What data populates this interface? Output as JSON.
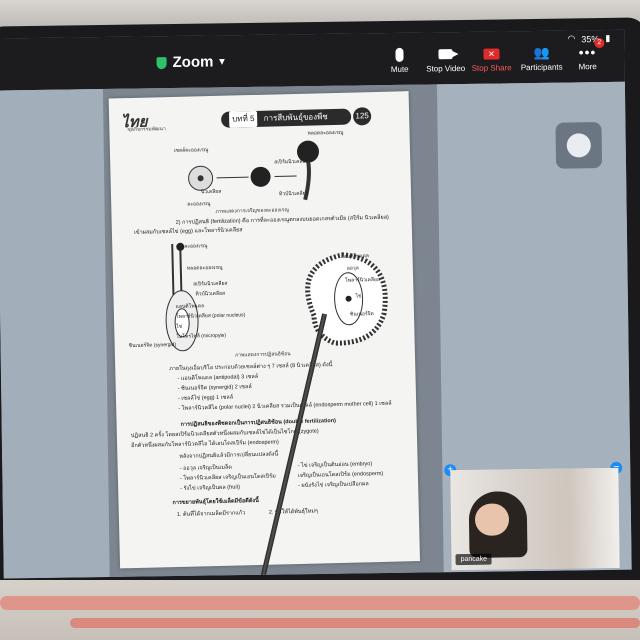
{
  "status": {
    "wifi_icon": "wifi-icon",
    "battery": "35%",
    "battery_icon": "battery-icon"
  },
  "app": {
    "title": "Zoom",
    "shield_icon": "shield-icon",
    "caret_icon": "chevron-down-icon"
  },
  "toolbar": {
    "mute": "Mute",
    "stop_video": "Stop Video",
    "stop_share": "Stop Share",
    "participants": "Participants",
    "more": "More",
    "more_badge": "2"
  },
  "document": {
    "logo": "ไทย",
    "logo_sub": "ชุดกิจกรรมพัฒนา",
    "chapter_tag": "บทที่ 5",
    "chapter_title": "การสืบพันธุ์ของพืช",
    "page_number": "125",
    "fig1_labels": [
      "เซลล์ละอองเรณู",
      "นิวเคลียส",
      "ละอองเรณู",
      "หลอดละอองเรณู",
      "สเปิร์มนิวเคลียส",
      "ทิวบ์นิวเคลียส"
    ],
    "fig1_caption": "ภาพแสดงการเจริญของละอองเรณู",
    "para1": "2) การปฏิสนธิ (fertilization) คือ การที่ละอองเรณูตกลงบนยอดเกสรตัวเมีย (สปิร์ม นิวเคลียส)",
    "para1b": "เข้าผสมกับเซลล์ไข่ (egg) และโพลาร์นิวเคลียส",
    "fig2_labels": [
      "ละอองเรณู",
      "หลอดละอองเรณู",
      "สเปิร์มนิวเคลียส",
      "ทิวบ์นิวเคลียส",
      "แอนติโพแดล",
      "โพลาร์นิวเคลียส (polar nucleus)",
      "ไข่",
      "ซินเนอร์จิด (synergid)",
      "ไมโครไพล์ (micropyle)"
    ],
    "fig2_right_labels": [
      "แอนติโพแดล",
      "ออวุล",
      "โพลาร์นิวเคลียส",
      "ไข่",
      "ซินเนอร์จิด"
    ],
    "fig2_caption": "ภาพแสดงการปฏิสนธิซ้อน",
    "list_intro": "ภายในถุงเอ็มบริโอ ประกอบด้วยเซลล์ต่าง ๆ 7 เซลล์ (8 นิวเคลียส) ดังนี้",
    "list": [
      "- แอนติโพแดล (antipodal) 3 เซลล์",
      "- ซินเนอร์จิด (synergid) 2 เซลล์",
      "- เซลล์ไข่ (egg) 1 เซลล์",
      "- โพลาร์นิวคลีไอ (polar nuclei) 2 นิวเคลียส รวมเป็นเซลล์ (endosperm mother cell) 1 เซลล์"
    ],
    "para2_bold": "การปฏิสนธิของพืชดอกเป็นการปฏิสนธิซ้อน (double fertilization)",
    "para2": "ปฏิสนธิ 2 ครั้ง โดยสเปิร์มนิวเคลียสตัวหนึ่งผสมกับเซลล์ไข่ได้เป็นไซโกต (zygote)",
    "para2b": "อีกตัวหนึ่งผสมกับโพลาร์นิวคลีไอ ได้เอนโดสเปิร์ม (endosperm)",
    "para3": "หลังจากปฏิสนธิแล้วมีการเปลี่ยนแปลงดังนี้",
    "changes_left": [
      "- ออวุล เจริญเป็นเมล็ด",
      "- โพลาร์นิวเคลียส เจริญเป็นเอนโดสเปิร์ม",
      "- รังไข่ เจริญเป็นผล (fruit)"
    ],
    "changes_right": [
      "- ไข่ เจริญเป็นต้นอ่อน (embryo)",
      "เจริญเป็นเอนโดสเปิร์ม (endosperm)",
      "- ผนังรังไข่ เจริญเป็นเปลือกผล"
    ],
    "section_bold": "การขยายพันธุ์โดยใช้เมล็ดมีข้อดีดังนี้",
    "numbered": [
      "1. ต้นที่ได้จากเมล็ดมีรากแก้ว",
      "2. ทำให้ได้พันธุ์ใหม่ๆ"
    ]
  },
  "video": {
    "participant_name": "pancake"
  }
}
